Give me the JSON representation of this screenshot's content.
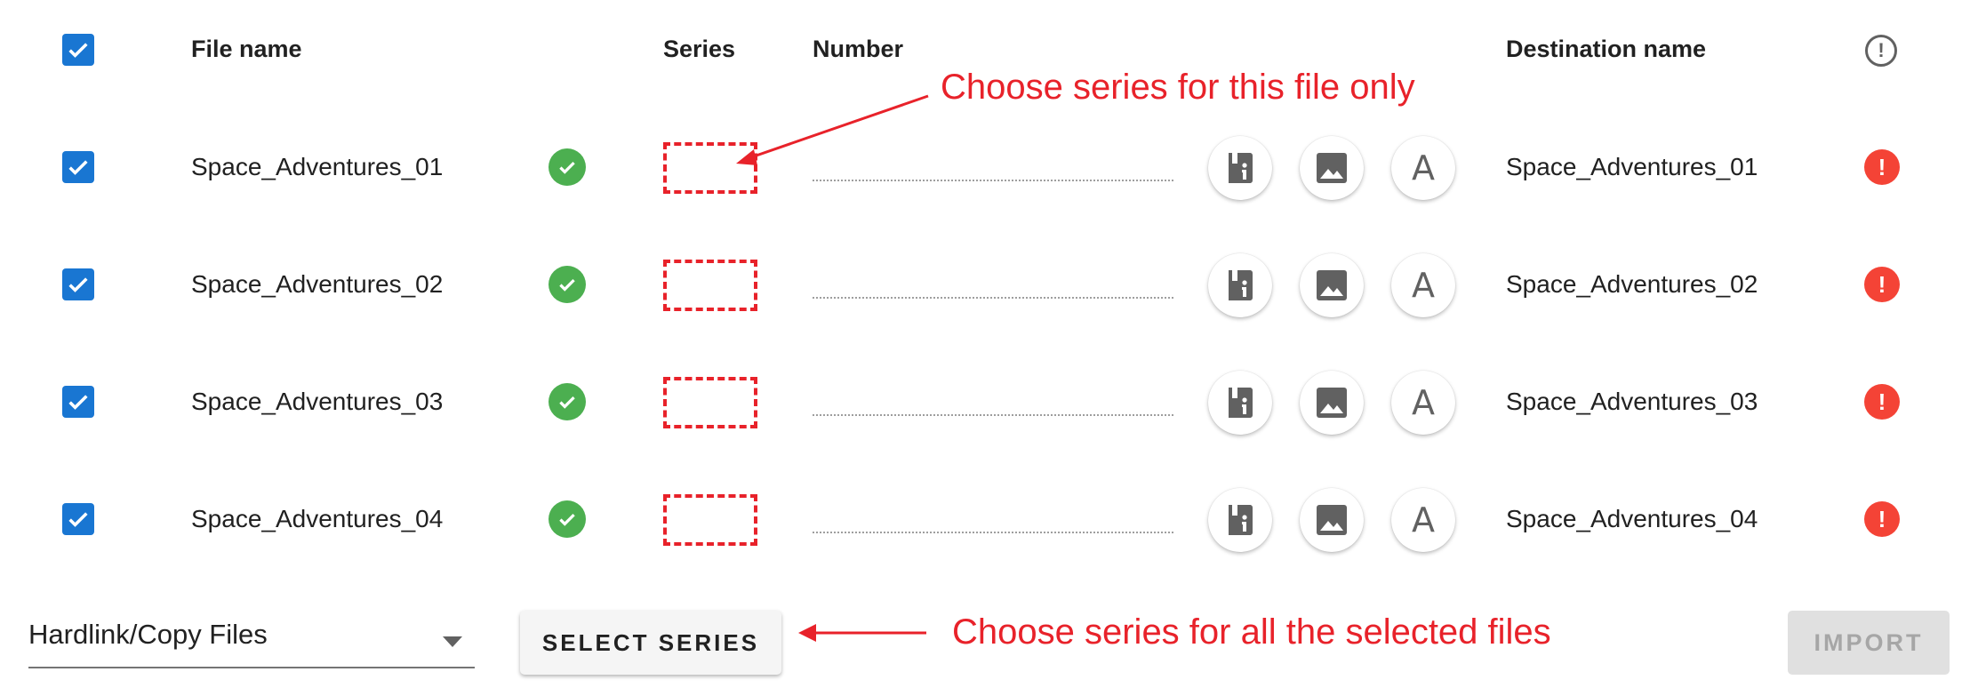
{
  "header": {
    "file_name": "File name",
    "series": "Series",
    "number": "Number",
    "destination_name": "Destination name"
  },
  "rows": [
    {
      "file_name": "Space_Adventures_01",
      "destination_name": "Space_Adventures_01",
      "checked": true
    },
    {
      "file_name": "Space_Adventures_02",
      "destination_name": "Space_Adventures_02",
      "checked": true
    },
    {
      "file_name": "Space_Adventures_03",
      "destination_name": "Space_Adventures_03",
      "checked": true
    },
    {
      "file_name": "Space_Adventures_04",
      "destination_name": "Space_Adventures_04",
      "checked": true
    }
  ],
  "row_buttons": {
    "metadata_icon": "book-info-icon",
    "cover_icon": "image-icon",
    "name_icon": "letter-a-icon",
    "name_letter": "A"
  },
  "footer": {
    "copy_mode": "Hardlink/Copy Files",
    "select_series_label": "SELECT SERIES",
    "import_label": "IMPORT"
  },
  "annotations": {
    "series_single": "Choose series for this file only",
    "series_all": "Choose series for all the selected files"
  },
  "colors": {
    "accent": "#1976d2",
    "success": "#4caf50",
    "error": "#f44336",
    "annotation": "#e8222a"
  }
}
